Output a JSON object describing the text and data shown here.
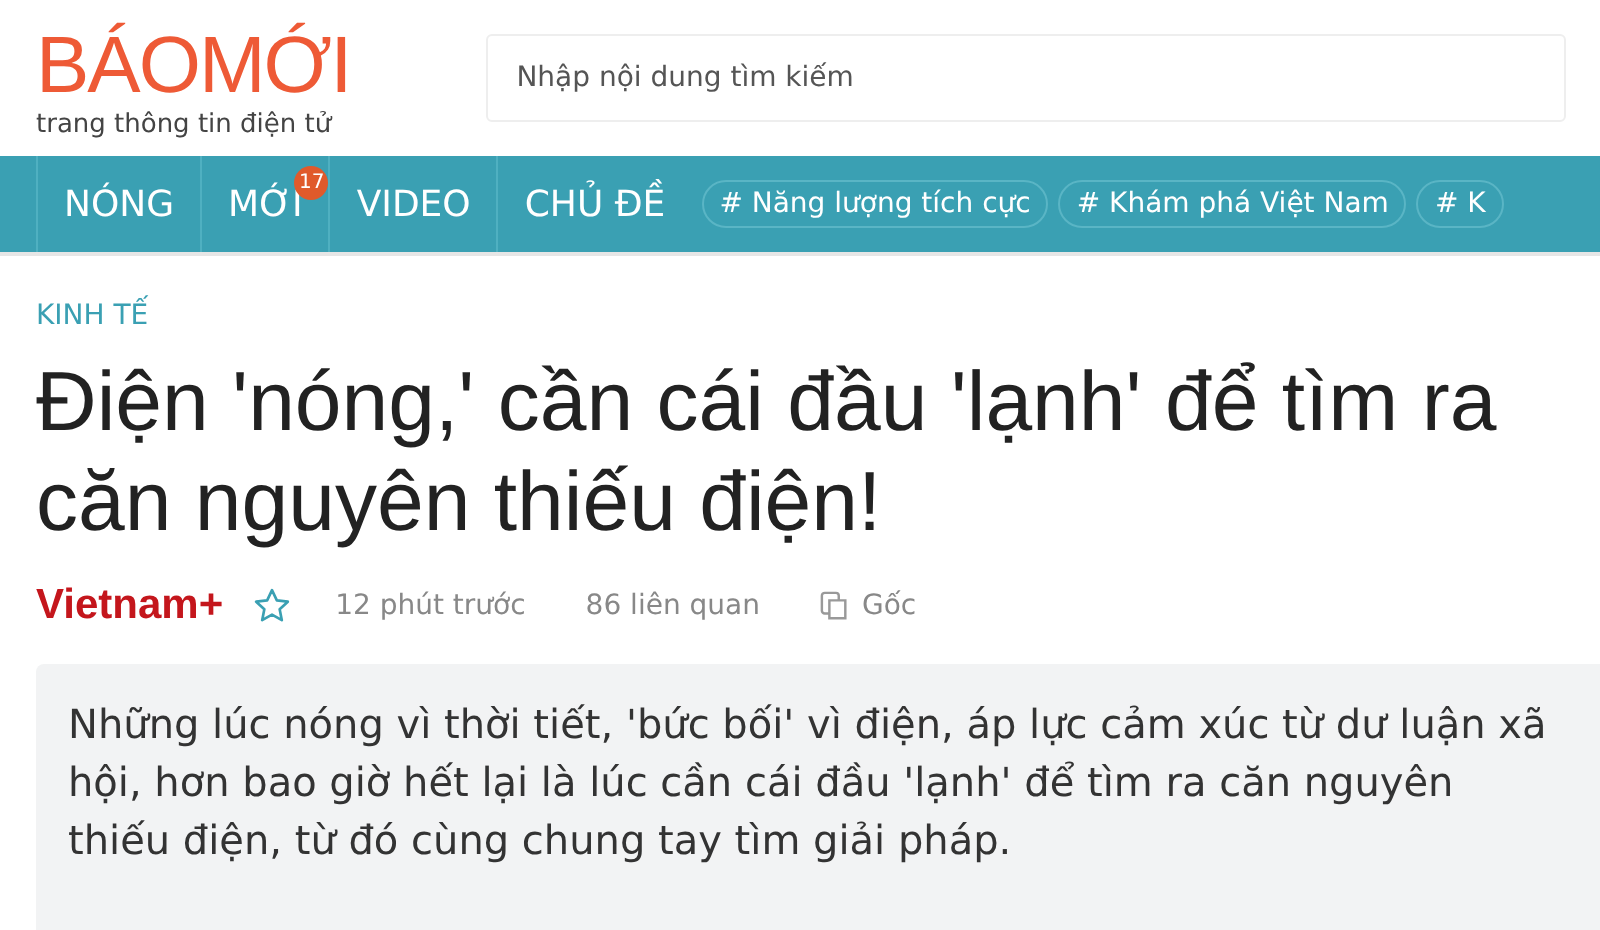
{
  "header": {
    "logo": "BÁOMỚI",
    "tagline": "trang thông tin điện tử",
    "search": {
      "placeholder": "Nhập nội dung tìm kiếm"
    }
  },
  "nav": {
    "items": [
      {
        "label": "NÓNG"
      },
      {
        "label": "MỚI",
        "badge": "17"
      },
      {
        "label": "VIDEO"
      },
      {
        "label": "CHỦ ĐỀ"
      }
    ],
    "tags": [
      "# Năng lượng tích cực",
      "# Khám phá Việt Nam",
      "# K"
    ]
  },
  "article": {
    "category": "KINH TẾ",
    "title": "Điện 'nóng,' cần cái đầu 'lạnh' để tìm ra căn nguyên thiếu điện!",
    "source": "Vietnam+",
    "time": "12 phút trước",
    "related": "86 liên quan",
    "original": "Gốc",
    "summary": "Những lúc nóng vì thời tiết, 'bức bối' vì điện, áp lực cảm xúc từ dư luận xã hội, hơn bao giờ hết lại là lúc cần cái đầu 'lạnh' để tìm ra căn nguyên thiếu điện, từ đó cùng chung tay tìm giải pháp."
  }
}
